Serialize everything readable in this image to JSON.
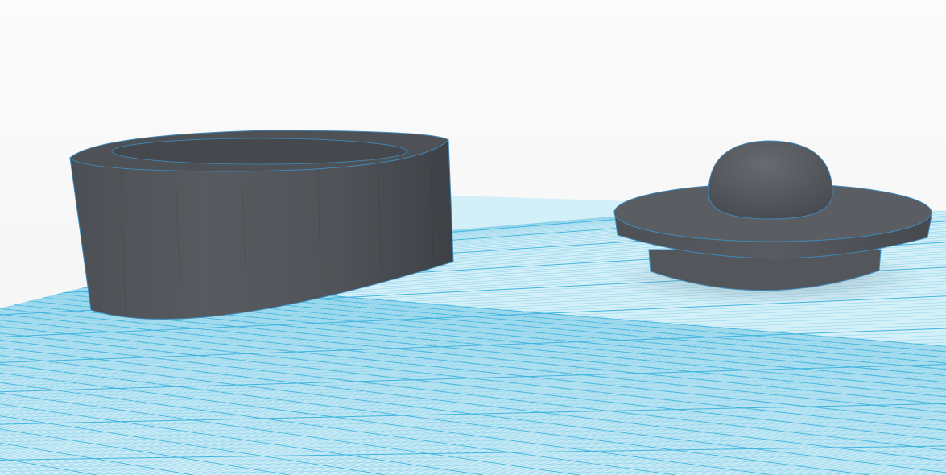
{
  "workspace": {
    "background_color": "#f7f7f7",
    "grid_fill_color": "#d3eff8",
    "grid_minor_color": "#8fd3ea",
    "grid_major_color": "#3fb4de"
  },
  "objects": [
    {
      "name": "container",
      "shape": "hollow-cylinder",
      "color": "#4a4e52",
      "edge_color": "#3f88b8"
    },
    {
      "name": "lid",
      "shape": "disc-with-sphere-knob",
      "color": "#55595d",
      "edge_color": "#3f88b8"
    }
  ]
}
